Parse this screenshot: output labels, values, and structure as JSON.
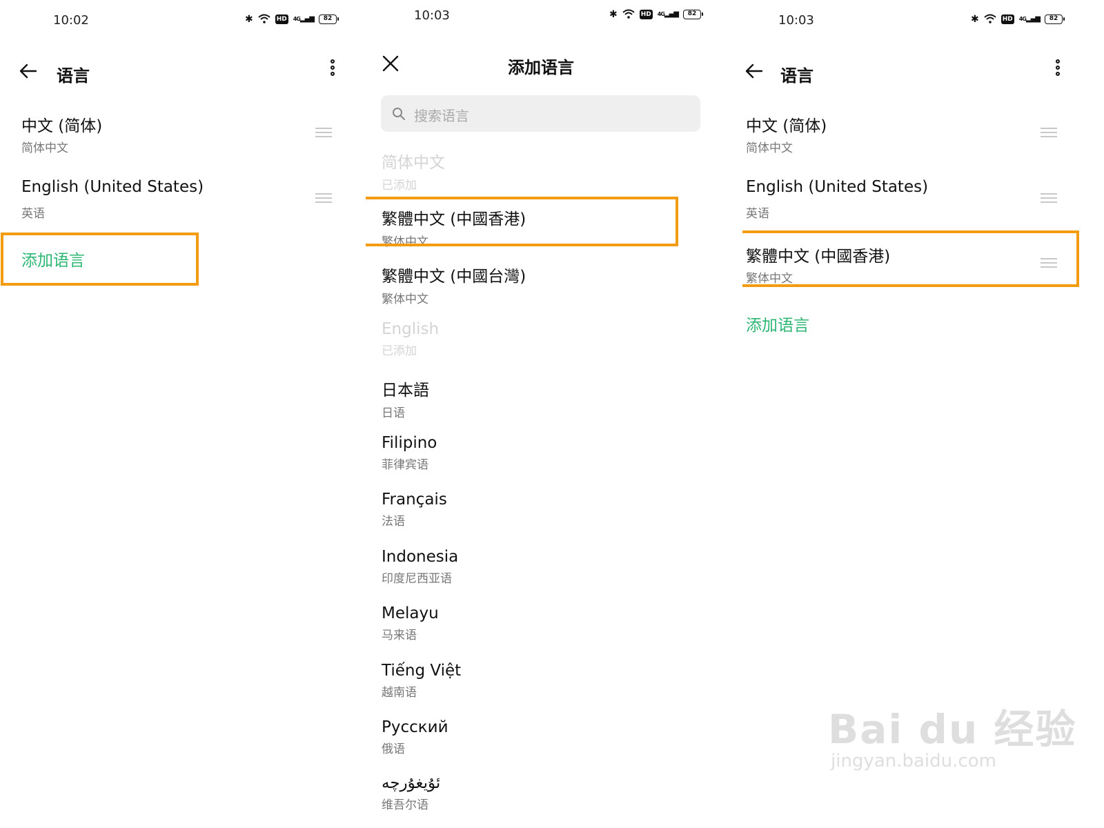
{
  "panel1": {
    "status": {
      "time": "10:02",
      "battery": "82",
      "network": "4G"
    },
    "header": {
      "title": "语言"
    },
    "languages": [
      {
        "primary": "中文 (简体)",
        "secondary": "简体中文"
      },
      {
        "primary": "English (United States)",
        "secondary": "英语"
      }
    ],
    "add_language": "添加语言"
  },
  "panel2": {
    "status": {
      "time": "10:03",
      "battery": "82",
      "network": "4G"
    },
    "title": "添加语言",
    "search": {
      "placeholder": "搜索语言"
    },
    "languages": [
      {
        "primary": "简体中文",
        "secondary": "已添加",
        "added": true
      },
      {
        "primary": "繁體中文 (中國香港)",
        "secondary": "繁体中文",
        "added": false
      },
      {
        "primary": "繁體中文 (中國台灣)",
        "secondary": "繁体中文",
        "added": false
      },
      {
        "primary": "English",
        "secondary": "已添加",
        "added": true
      },
      {
        "primary": "日本語",
        "secondary": "日语",
        "added": false
      },
      {
        "primary": "Filipino",
        "secondary": "菲律宾语",
        "added": false
      },
      {
        "primary": "Français",
        "secondary": "法语",
        "added": false
      },
      {
        "primary": "Indonesia",
        "secondary": "印度尼西亚语",
        "added": false
      },
      {
        "primary": "Melayu",
        "secondary": "马来语",
        "added": false
      },
      {
        "primary": "Tiếng Việt",
        "secondary": "越南语",
        "added": false
      },
      {
        "primary": "Русский",
        "secondary": "俄语",
        "added": false
      },
      {
        "primary": "ئۇيغۇرچە",
        "secondary": "维吾尔语",
        "added": false
      }
    ]
  },
  "panel3": {
    "status": {
      "time": "10:03",
      "battery": "82",
      "network": "4G"
    },
    "header": {
      "title": "语言"
    },
    "languages": [
      {
        "primary": "中文 (简体)",
        "secondary": "简体中文"
      },
      {
        "primary": "English (United States)",
        "secondary": "英语"
      },
      {
        "primary": "繁體中文 (中國香港)",
        "secondary": "繁体中文"
      }
    ],
    "add_language": "添加语言"
  },
  "watermark": {
    "line1": "Bai du 经验",
    "line2": "jingyan.baidu.com"
  },
  "colors": {
    "accent_green": "#2bb673",
    "highlight_orange": "#f39c12",
    "added_gray": "#d4d4d4"
  }
}
